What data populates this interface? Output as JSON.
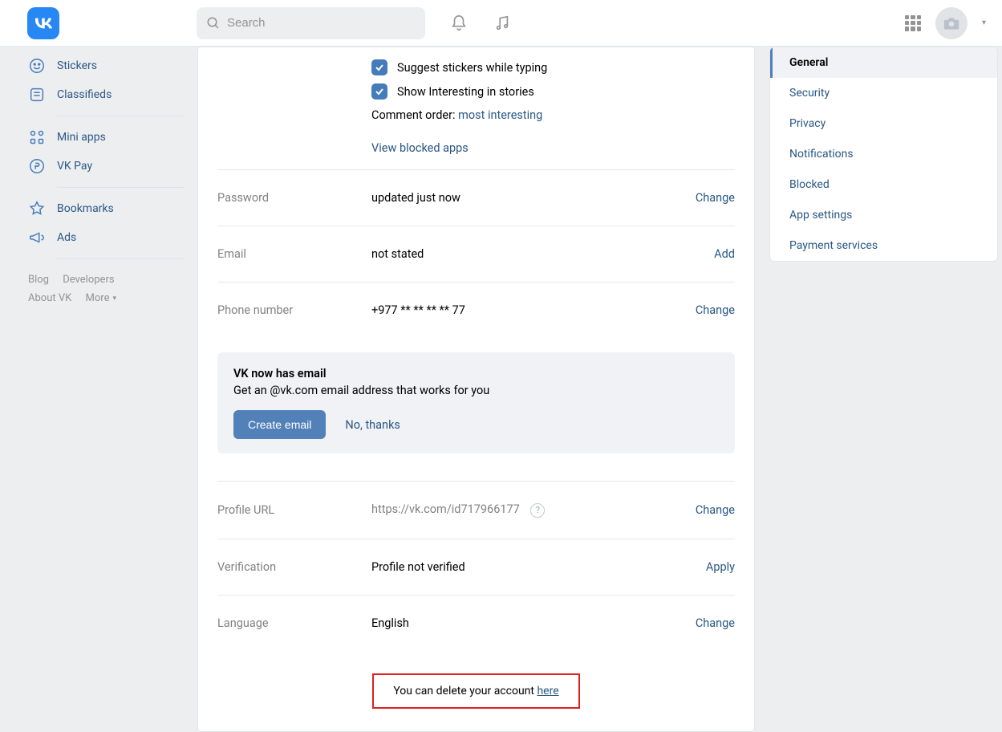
{
  "header": {
    "search_placeholder": "Search"
  },
  "leftnav": {
    "items": [
      {
        "label": "Stickers"
      },
      {
        "label": "Classifieds"
      },
      {
        "label": "Mini apps"
      },
      {
        "label": "VK Pay"
      },
      {
        "label": "Bookmarks"
      },
      {
        "label": "Ads"
      }
    ],
    "footer": {
      "blog": "Blog",
      "developers": "Developers",
      "about": "About VK",
      "more": "More"
    }
  },
  "settings": {
    "checkbox1": "Suggest stickers while typing",
    "checkbox2": "Show Interesting in stories",
    "comment_order_label": "Comment order:",
    "comment_order_value": "most interesting",
    "view_blocked": "View blocked apps",
    "rows": {
      "password": {
        "label": "Password",
        "value": "updated just now",
        "action": "Change"
      },
      "email": {
        "label": "Email",
        "value": "not stated",
        "action": "Add"
      },
      "phone": {
        "label": "Phone number",
        "value": "+977 ** ** ** ** 77",
        "action": "Change"
      },
      "url": {
        "label": "Profile URL",
        "value": "https://vk.com/id717966177",
        "action": "Change"
      },
      "verification": {
        "label": "Verification",
        "value": "Profile not verified",
        "action": "Apply"
      },
      "language": {
        "label": "Language",
        "value": "English",
        "action": "Change"
      }
    },
    "promo": {
      "title": "VK now has email",
      "desc": "Get an @vk.com email address that works for you",
      "create": "Create email",
      "decline": "No, thanks"
    },
    "delete_prefix": "You can delete your account ",
    "delete_link": "here"
  },
  "tabs": [
    "General",
    "Security",
    "Privacy",
    "Notifications",
    "Blocked",
    "App settings",
    "Payment services"
  ]
}
